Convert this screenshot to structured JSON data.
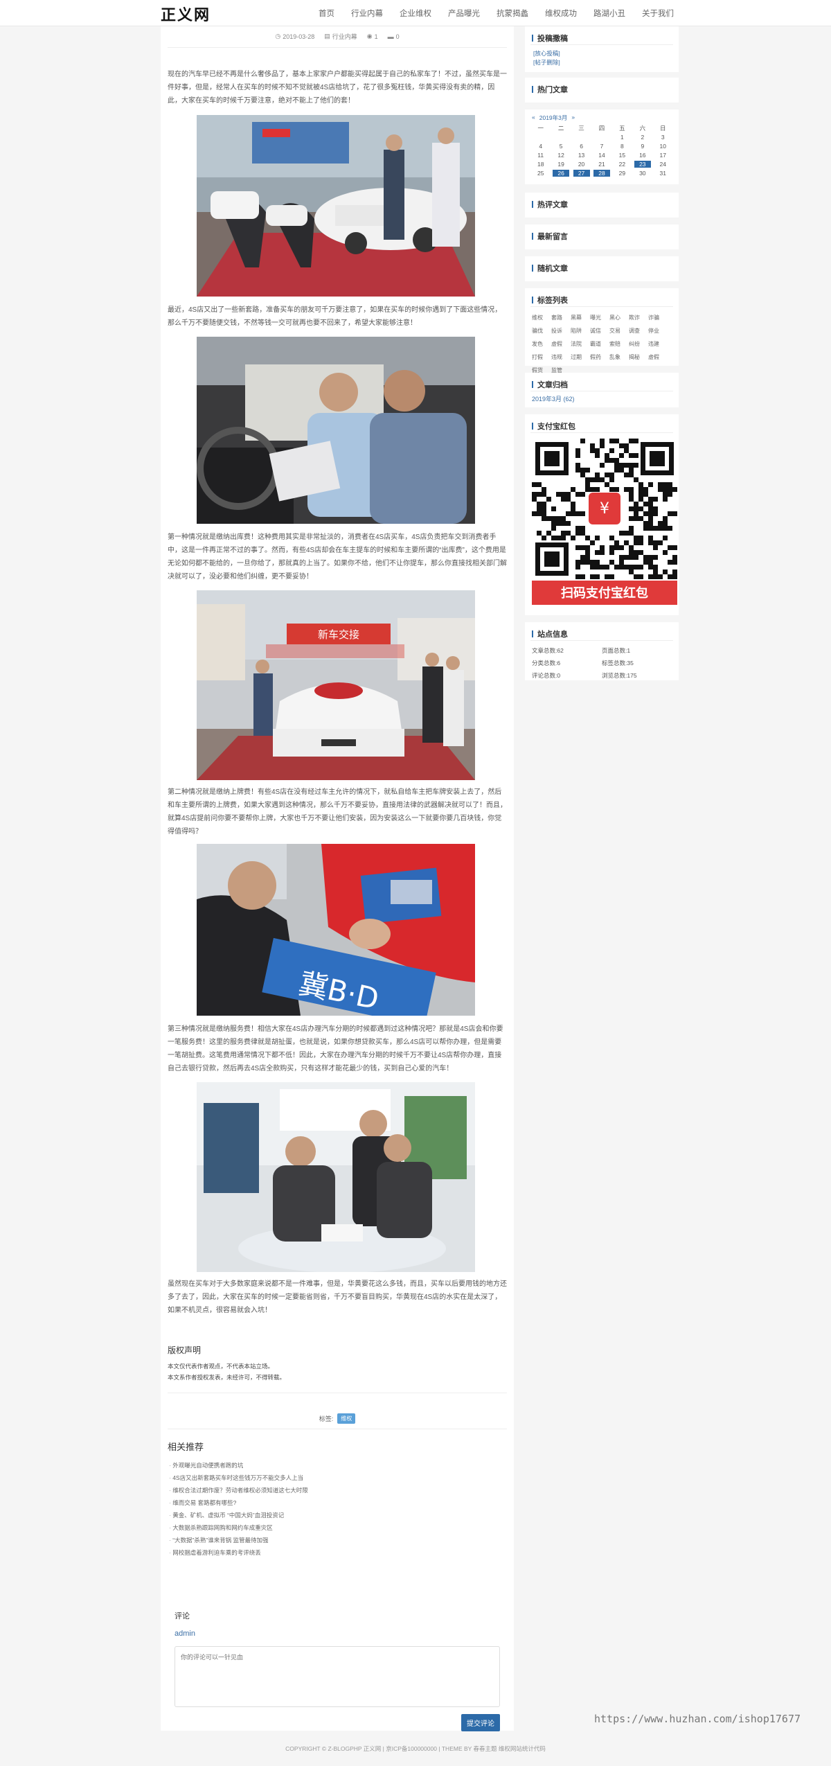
{
  "header": {
    "logo": "正义网",
    "nav": [
      "首页",
      "行业内幕",
      "企业维权",
      "产品曝光",
      "抗蒙揭蠡",
      "维权成功",
      "路湖小丑",
      "关于我们"
    ]
  },
  "article": {
    "date": "2019-03-28",
    "category": "行业内幕",
    "views": "1",
    "comments": "0",
    "paragraphs": [
      "现在的汽车早已经不再是什么奢侈品了，基本上家家户户都能买得起属于自己的私家车了！不过，虽然买车是一件好事，但是，经常人在买车的时候不知不觉就被4S店给坑了，花了很多冤枉钱，华黄买得没有卖的精，因此，大家在买车的时候千万要注意，绝对不能上了他们的套！",
      "最近，4S店又出了一些新套路，准备买车的朋友可千万要注意了，如果在买车的时候你遇到了下面这些情况，那么千万不要随便交钱，不然等钱一交可就再也要不回来了，希望大家能够注意！",
      "第一种情况就是缴纳出库费！这种费用其实是非常扯淡的，消费者在4S店买车，4S店负责把车交到消费者手中，这是一件再正常不过的事了。然而，有些4S店却会在车主提车的时候和车主要所谓的“出库费”，这个费用是无论如何都不能给的，一旦你给了，那就真的上当了。如果你不给，他们不让你提车，那么你直接找相关部门解决就可以了，没必要和他们纠缠，更不要妥协！",
      "第二种情况就是缴纳上牌费！有些4S店在没有经过车主允许的情况下，就私自给车主把车牌安装上去了，然后和车主要所谓的上牌费，如果大家遇到这种情况，那么千万不要妥协，直接用法律的武器解决就可以了！而且，就算4S店提前问你要不要帮你上牌，大家也千万不要让他们安装，因为安装这么一下就要你要几百块钱，你觉得值得吗？",
      "第三种情况就是缴纳服务费！相信大家在4S店办理汽车分期的时候都遇到过这种情况吧？那就是4S店会和你要一笔服务费！这里的服务费律就是胡扯蛋，也就是说，如果你想贷款买车，那么4S店可以帮你办理，但是需要一笔胡扯费。这笔费用通常情况下都不低！因此，大家在办理汽车分期的时候千万不要让4S店帮你办理，直接自己去银行贷款，然后再去4S店全款购买，只有这样才能花最少的钱，买到自己心爱的汽车！",
      "虽然现在买车对于大多数家庭来说都不是一件难事，但是，华黄要花这么多钱，而且，买车以后要用钱的地方还多了去了，因此，大家在买车的时候一定要能省则省，千万不要盲目购买，华黄现在4S店的水实在是太深了，如果不机灵点，很容易就会入坑！"
    ],
    "copyright_title": "版权声明",
    "copyright_lines": [
      "本文仅代表作者观点，不代表本站立场。",
      "本文系作者授权发表，未经许可，不得转载。"
    ],
    "tags_label": "标签:",
    "tags": [
      "维权"
    ],
    "related_title": "相关推荐",
    "related": [
      "外观曝光自动便携者跑的坑",
      "4S店又出新套路买车时这些钱万万不能交多人上当",
      "维权合法过期作废？劳动者维权必须知道这七大时限",
      "维而交易 套路都有哪些?",
      "黄金、矿机、虚拟币 “中国大妈”血泪投资记",
      "大数据杀熟跟踪网购和网约车成重灾区",
      "“大数据”杀熟”谁来背锅 监管最待加强",
      "网校捆虐着游利迫车乘的考评绕丢"
    ]
  },
  "comment_form": {
    "title": "评论",
    "user": "admin",
    "placeholder": "你的评论可以一针见血",
    "submit": "提交评论"
  },
  "sidebar": {
    "w1_title": "投稿撒稿",
    "w1_links": [
      "[放心投稿]",
      "[帖子删除]"
    ],
    "hot_title": "热门文章",
    "calendar": {
      "prev": "«",
      "month": "2019年3月",
      "next": "»",
      "weekdays": [
        "一",
        "二",
        "三",
        "四",
        "五",
        "六",
        "日"
      ],
      "rows": [
        [
          "",
          "",
          "",
          "",
          "1",
          "2",
          "3"
        ],
        [
          "4",
          "5",
          "6",
          "7",
          "8",
          "9",
          "10"
        ],
        [
          "11",
          "12",
          "13",
          "14",
          "15",
          "16",
          "17"
        ],
        [
          "18",
          "19",
          "20",
          "21",
          "22",
          "23",
          "24"
        ],
        [
          "25",
          "26",
          "27",
          "28",
          "29",
          "30",
          "31"
        ]
      ],
      "highlighted": [
        "23",
        "26",
        "27",
        "28"
      ]
    },
    "hot_comment_title": "热评文章",
    "latest_msg_title": "最新留言",
    "random_title": "随机文章",
    "tagcloud_title": "标签列表",
    "tagcloud": [
      "维权",
      "套路",
      "黑幕",
      "曝光",
      "黑心",
      "欺诈",
      "诈骗",
      "骗伐",
      "投诉",
      "陷阱",
      "诚信",
      "交易",
      "调查",
      "停业",
      "发色",
      "虚假",
      "法院",
      "霸道",
      "索赔",
      "纠纷",
      "违建",
      "打假",
      "违规",
      "过期",
      "假药",
      "乱象",
      "揭秘",
      "虚假",
      "假货",
      "监管"
    ],
    "archive_title": "文章归档",
    "archive": "2019年3月 (62)",
    "alipay_title": "支付宝红包",
    "alipay_banner": "扫码支付宝红包",
    "stats_title": "站点信息",
    "stats": [
      "文章总数:62",
      "页面总数:1",
      "分类总数:6",
      "标签总数:35",
      "评论总数:0",
      "浏览总数:175"
    ]
  },
  "footer": "COPYRIGHT © Z-BLOGPHP 正义网 | 京ICP备100000000 | THEME BY 春春主题 维权网站统计代码",
  "watermark": "https://www.huzhan.com/ishop17677",
  "colors": {
    "accent": "#2c6aa8",
    "tag": "#5aa0d8",
    "banner_red": "#e03a3a"
  }
}
